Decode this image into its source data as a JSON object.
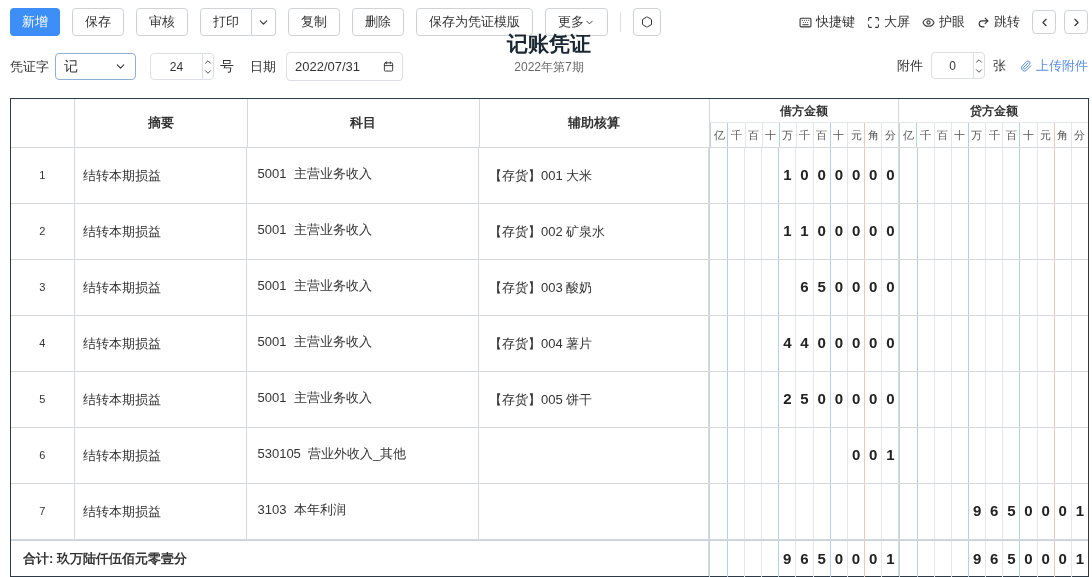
{
  "toolbar": {
    "buttons": [
      {
        "label": "新增",
        "kind": "primary"
      },
      {
        "label": "保存",
        "kind": "plain"
      },
      {
        "label": "审核",
        "kind": "plain"
      },
      {
        "label": "打印",
        "kind": "split"
      },
      {
        "label": "复制",
        "kind": "plain"
      },
      {
        "label": "删除",
        "kind": "plain"
      },
      {
        "label": "保存为凭证模版",
        "kind": "plain"
      },
      {
        "label": "更多",
        "kind": "menu"
      },
      {
        "kind": "icon"
      }
    ],
    "links": [
      {
        "label": "快捷键",
        "kind": "keyboard"
      },
      {
        "label": "大屏",
        "kind": "fullscreen"
      },
      {
        "label": "护眼",
        "kind": "eye"
      },
      {
        "label": "跳转",
        "kind": "jump"
      }
    ]
  },
  "voucher": {
    "word_label": "凭证字",
    "word": "记",
    "number": "24",
    "number_unit": "号",
    "date_label": "日期",
    "date": "2022/07/31",
    "title": "记账凭证",
    "period": "2022年第7期",
    "attachments_label": "附件",
    "attachments": "0",
    "attachments_unit": "张",
    "upload": "上传附件"
  },
  "table": {
    "columns": [
      "摘要",
      "科目",
      "辅助核算"
    ],
    "debit": "借方金额",
    "credit": "贷方金额",
    "debit_units": [
      "亿",
      "千",
      "百",
      "十",
      "万",
      "千",
      "百",
      "十",
      "元",
      "角",
      "分"
    ],
    "credit_units": [
      "亿",
      "千",
      "百",
      "十",
      "万",
      "千",
      "百",
      "十",
      "元",
      "角",
      "分"
    ],
    "rows": [
      {
        "no": "1",
        "summary": "结转本期损益",
        "account": "5001  主营业务收入",
        "aux": "【存货】001 大米",
        "debit": [
          "1",
          "0",
          "0",
          "0",
          "0",
          "0",
          "0"
        ]
      },
      {
        "no": "2",
        "summary": "结转本期损益",
        "account": "5001  主营业务收入",
        "aux": "【存货】002 矿泉水",
        "debit": [
          "1",
          "1",
          "0",
          "0",
          "0",
          "0",
          "0"
        ]
      },
      {
        "no": "3",
        "summary": "结转本期损益",
        "account": "5001  主营业务收入",
        "aux": "【存货】003 酸奶",
        "debit": [
          "6",
          "5",
          "0",
          "0",
          "0",
          "0"
        ]
      },
      {
        "no": "4",
        "summary": "结转本期损益",
        "account": "5001  主营业务收入",
        "aux": "【存货】004 薯片",
        "debit": [
          "4",
          "4",
          "0",
          "0",
          "0",
          "0",
          "0"
        ]
      },
      {
        "no": "5",
        "summary": "结转本期损益",
        "account": "5001  主营业务收入",
        "aux": "【存货】005 饼干",
        "debit": [
          "2",
          "5",
          "0",
          "0",
          "0",
          "0",
          "0"
        ]
      },
      {
        "no": "6",
        "summary": "结转本期损益",
        "account": "530105  营业外收入_其他",
        "debit": [
          "0",
          "0",
          "1"
        ]
      },
      {
        "no": "7",
        "summary": "结转本期损益",
        "account": "3103  本年利润",
        "credit": [
          "9",
          "6",
          "5",
          "0",
          "0",
          "0",
          "1"
        ]
      }
    ],
    "total": {
      "label": "合计: 玖万陆仟伍佰元零壹分",
      "debit": [
        "9",
        "6",
        "5",
        "0",
        "0",
        "0",
        "1"
      ],
      "credit": [
        "9",
        "6",
        "5",
        "0",
        "0",
        "0",
        "1"
      ]
    }
  }
}
